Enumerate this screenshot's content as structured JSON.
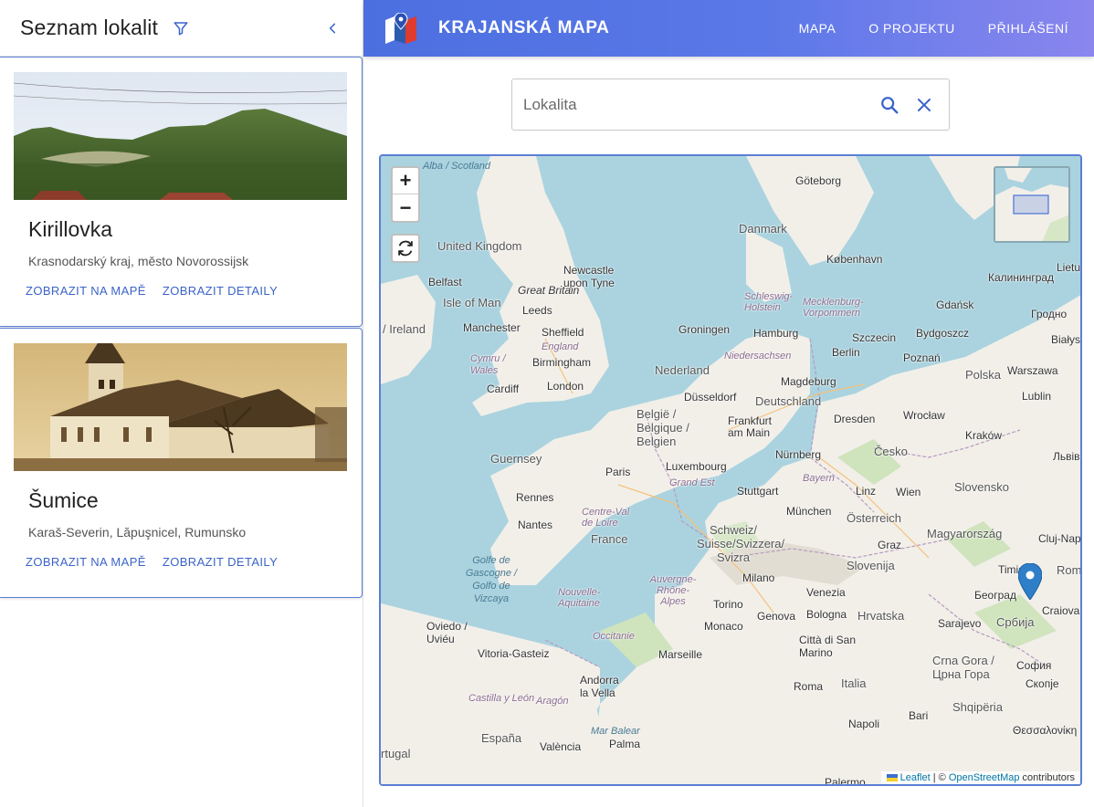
{
  "sidebar": {
    "title": "Seznam lokalit",
    "filter_icon": "filter-icon",
    "collapse_icon": "chevron-left-icon",
    "cards": [
      {
        "name": "Kirillovka",
        "subtitle": "Krasnodarský kraj, město Novorossijsk",
        "show_on_map": "ZOBRAZIT NA MAPĚ",
        "show_details": "ZOBRAZIT DETAILY"
      },
      {
        "name": "Šumice",
        "subtitle": "Karaš-Severin, Lăpuşnicel, Rumunsko",
        "show_on_map": "ZOBRAZIT NA MAPĚ",
        "show_details": "ZOBRAZIT DETAILY"
      }
    ]
  },
  "header": {
    "brand": "KRAJANSKÁ MAPA",
    "nav": [
      "MAPA",
      "O PROJEKTU",
      "PŘIHLÁŠENÍ"
    ]
  },
  "search": {
    "placeholder": "Lokalita"
  },
  "map": {
    "zoom_in": "+",
    "zoom_out": "−",
    "attribution": {
      "leaflet": "Leaflet",
      "separator": " | © ",
      "osm": "OpenStreetMap",
      "suffix": " contributors"
    },
    "labels": {
      "alba": "Alba / Scotland",
      "goteborg": "Göteborg",
      "danmark": "Danmark",
      "kobenhavn": "København",
      "kaliningrad": "Калининград",
      "lietuva": "Lietuv",
      "uk": "United Kingdom",
      "newcastle": "Newcastle upon Tyne",
      "belfast": "Belfast",
      "great_britain": "Great Britain",
      "isle_of_man": "Isle of Man",
      "leeds": "Leeds",
      "ireland": "/ Ireland",
      "manchester": "Manchester",
      "sheffield": "Sheffield",
      "england": "England",
      "cymru": "Cymru / Wales",
      "birmingham": "Birmingham",
      "cardiff": "Cardiff",
      "london": "London",
      "groningen": "Groningen",
      "hamburg": "Hamburg",
      "szczecin": "Szczecin",
      "bydgoszcz": "Bydgoszcz",
      "gdansk": "Gdańsk",
      "grodno": "Гродно",
      "bialystok": "Białyst",
      "schleswig": "Schleswig-Holstein",
      "mecklenburg": "Mecklenburg-Vorpommern",
      "niedersachsen": "Niedersachsen",
      "berlin": "Berlin",
      "poznan": "Poznań",
      "polska": "Polska",
      "warszawa": "Warszawa",
      "nederland": "Nederland",
      "magdeburg": "Magdeburg",
      "dusseldorf": "Düsseldorf",
      "deutschland": "Deutschland",
      "lublin": "Lublin",
      "belgie": "België / Belgique / Belgien",
      "frankfurt": "Frankfurt am Main",
      "dresden": "Dresden",
      "wroclaw": "Wrocław",
      "krakow": "Kraków",
      "cesko": "Česko",
      "lviv": "Львів",
      "guernsey": "Guernsey",
      "paris": "Paris",
      "luxembourg": "Luxembourg",
      "nurnberg": "Nürnberg",
      "grand_est": "Grand Est",
      "bayern": "Bayern",
      "stuttgart": "Stuttgart",
      "rennes": "Rennes",
      "linz": "Linz",
      "wien": "Wien",
      "slovensko": "Slovensko",
      "nantes": "Nantes",
      "centre": "Centre-Val de Loire",
      "munchen": "München",
      "osterreich": "Österreich",
      "france": "France",
      "schweiz": "Schweiz/ Suisse/Svizzera/ Svizra",
      "magyarorszag": "Magyarország",
      "cluj": "Cluj-Napoc",
      "graz": "Graz",
      "golfe": "Golfe de Gascogne / Golfo de Vizcaya",
      "slovenija": "Slovenija",
      "timisoara": "Timișoa",
      "romania": "Român",
      "auvergne": "Auvergne-Rhône-Alpes",
      "milano": "Milano",
      "venezia": "Venezia",
      "beograd": "Београд",
      "nouvelle": "Nouvelle-Aquitaine",
      "torino": "Torino",
      "hrvatska": "Hrvatska",
      "craiova": "Craiova",
      "genova": "Genova",
      "bologna": "Bologna",
      "sarajevo": "Sarajevo",
      "srbija": "Србија",
      "oviedo": "Oviedo / Uviéu",
      "monaco": "Monaco",
      "occitanie": "Occitanie",
      "san_marino": "Città di San Marino",
      "vitoria": "Vitoria-Gasteiz",
      "marseille": "Marseille",
      "crna_gora": "Crna Gora / Црна Гора",
      "sofia": "София",
      "andorra": "Andorra la Vella",
      "italia": "Italia",
      "roma": "Roma",
      "skopje": "Скопје",
      "castilla": "Castilla y León",
      "aragon": "Aragón",
      "shqiperia": "Shqipëria",
      "espana": "España",
      "mar_balear": "Mar Balear",
      "napoli": "Napoli",
      "bari": "Bari",
      "thessaloniki": "Θεσσαλονίκη",
      "portugal": "rtugal",
      "valencia": "València",
      "palma": "Palma",
      "palermo": "Palermo"
    }
  }
}
